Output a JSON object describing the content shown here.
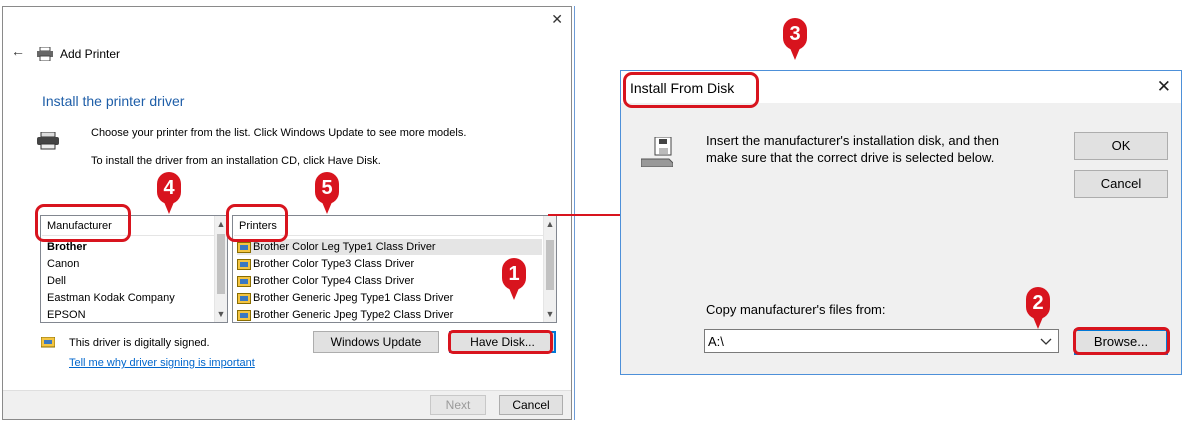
{
  "left_window": {
    "title": "Add Printer",
    "heading": "Install the printer driver",
    "instruction_line1": "Choose your printer from the list. Click Windows Update to see more models.",
    "instruction_line2": "To install the driver from an installation CD, click Have Disk.",
    "manufacturer_header": "Manufacturer",
    "manufacturers": [
      "Brother",
      "Canon",
      "Dell",
      "Eastman Kodak Company",
      "EPSON"
    ],
    "printers_header": "Printers",
    "printers": [
      "Brother Color Leg Type1 Class Driver",
      "Brother Color Type3 Class Driver",
      "Brother Color Type4 Class Driver",
      "Brother Generic Jpeg Type1 Class Driver",
      "Brother Generic Jpeg Type2 Class Driver"
    ],
    "signed_text": "This driver is digitally signed.",
    "signing_link": "Tell me why driver signing is important",
    "windows_update_label": "Windows Update",
    "have_disk_label": "Have Disk...",
    "next_label": "Next",
    "cancel_label": "Cancel",
    "close_glyph": "✕"
  },
  "right_dialog": {
    "title": "Install From Disk",
    "message_line1": "Insert the manufacturer's installation disk, and then",
    "message_line2": "make sure that the correct drive is selected below.",
    "ok_label": "OK",
    "cancel_label": "Cancel",
    "copy_label": "Copy manufacturer's files from:",
    "path_value": "A:\\",
    "browse_label": "Browse...",
    "close_glyph": "✕"
  },
  "callouts": [
    "1",
    "2",
    "3",
    "4",
    "5"
  ],
  "colors": {
    "callout_red": "#d8141e",
    "link_blue": "#0066cc",
    "heading_blue": "#1e5ea8",
    "focus_blue": "#0078d7"
  },
  "icons": [
    "back-arrow-icon",
    "printer-icon",
    "printer-large-icon",
    "certificate-icon",
    "disk-drive-icon",
    "close-icon",
    "chevron-down-icon"
  ]
}
